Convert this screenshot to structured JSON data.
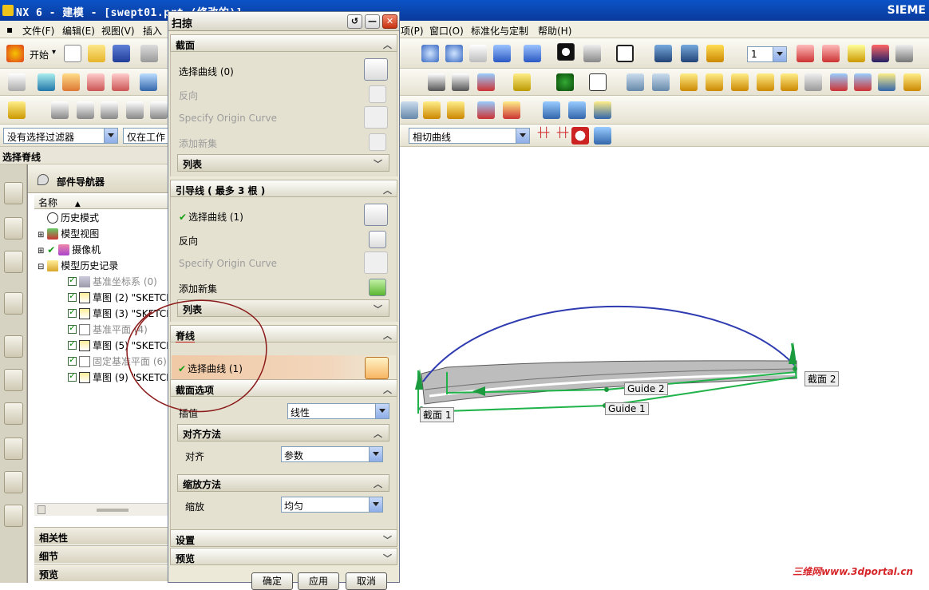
{
  "window": {
    "title": "NX 6 - 建模 - [swept01.prt (修改的)]",
    "brand": "SIEME"
  },
  "menu": [
    "文件(F)",
    "编辑(E)",
    "视图(V)",
    "插入",
    "项(P)",
    "窗口(O)",
    "标准化与定制",
    "帮助(H)"
  ],
  "toolbar": {
    "start_label": "开始",
    "start_arrow": "▾",
    "layer_value": "1",
    "filter_value": "没有选择过滤器",
    "scope_value": "仅在工作",
    "curve_rule_value": "相切曲线"
  },
  "status": {
    "prompt": "选择脊线"
  },
  "navigator": {
    "title": "部件导航器",
    "column_name": "名称",
    "column_sort": "▲",
    "expand_symbol": "⊞",
    "collapse_symbol": "⊟",
    "nodes": [
      {
        "label": "历史模式",
        "greyed": false
      },
      {
        "label": "模型视图",
        "greyed": false
      },
      {
        "label": "摄像机",
        "greyed": false
      },
      {
        "label": "模型历史记录",
        "greyed": false
      },
      {
        "label": "基准坐标系 (0)",
        "greyed": true
      },
      {
        "label": "草图 (2) \"SKETCH",
        "greyed": false
      },
      {
        "label": "草图 (3) \"SKETCH",
        "greyed": false
      },
      {
        "label": "基准平面 (4)",
        "greyed": true
      },
      {
        "label": "草图 (5) \"SKETCH",
        "greyed": false
      },
      {
        "label": "固定基准平面 (6)",
        "greyed": true
      },
      {
        "label": "草图 (9) \"SKETCH",
        "greyed": false
      }
    ],
    "panels": [
      "相关性",
      "细节",
      "预览"
    ]
  },
  "dialog": {
    "title": "扫掠",
    "close_symbol": "✕",
    "minimize_symbol": "—",
    "reset_symbol": "↺",
    "section": {
      "header": "截面",
      "select_curve": "选择曲线 (0)",
      "reverse": "反向",
      "origin_curve": "Specify Origin Curve",
      "add_new": "添加新集",
      "list": "列表"
    },
    "guide": {
      "header": "引导线 ( 最多 3 根 )",
      "select_curve": "选择曲线 (1)",
      "reverse": "反向",
      "origin_curve": "Specify Origin Curve",
      "add_new": "添加新集",
      "list": "列表"
    },
    "spine": {
      "header": "脊线",
      "select_curve": "选择曲线 (1)"
    },
    "section_options": {
      "header": "截面选项",
      "interpolation_label": "插值",
      "interpolation_value": "线性",
      "alignment_header": "对齐方法",
      "alignment_label": "对齐",
      "alignment_value": "参数",
      "scaling_header": "缩放方法",
      "scaling_label": "缩放",
      "scaling_value": "均匀"
    },
    "settings": "设置",
    "preview": "预览",
    "buttons": {
      "ok": "确定",
      "apply": "应用",
      "cancel": "取消"
    }
  },
  "graphics": {
    "labels": [
      "截面 1",
      "截面 2",
      "Guide 1",
      "Guide 2"
    ],
    "watermark": "三维网www.3dportal.cn"
  },
  "colors": {
    "guide_curve": "#1fb34a",
    "spine_curve": "#2e3bb0",
    "surface": "#a9a9a9",
    "annotation_circle": "#8b1a1a"
  }
}
